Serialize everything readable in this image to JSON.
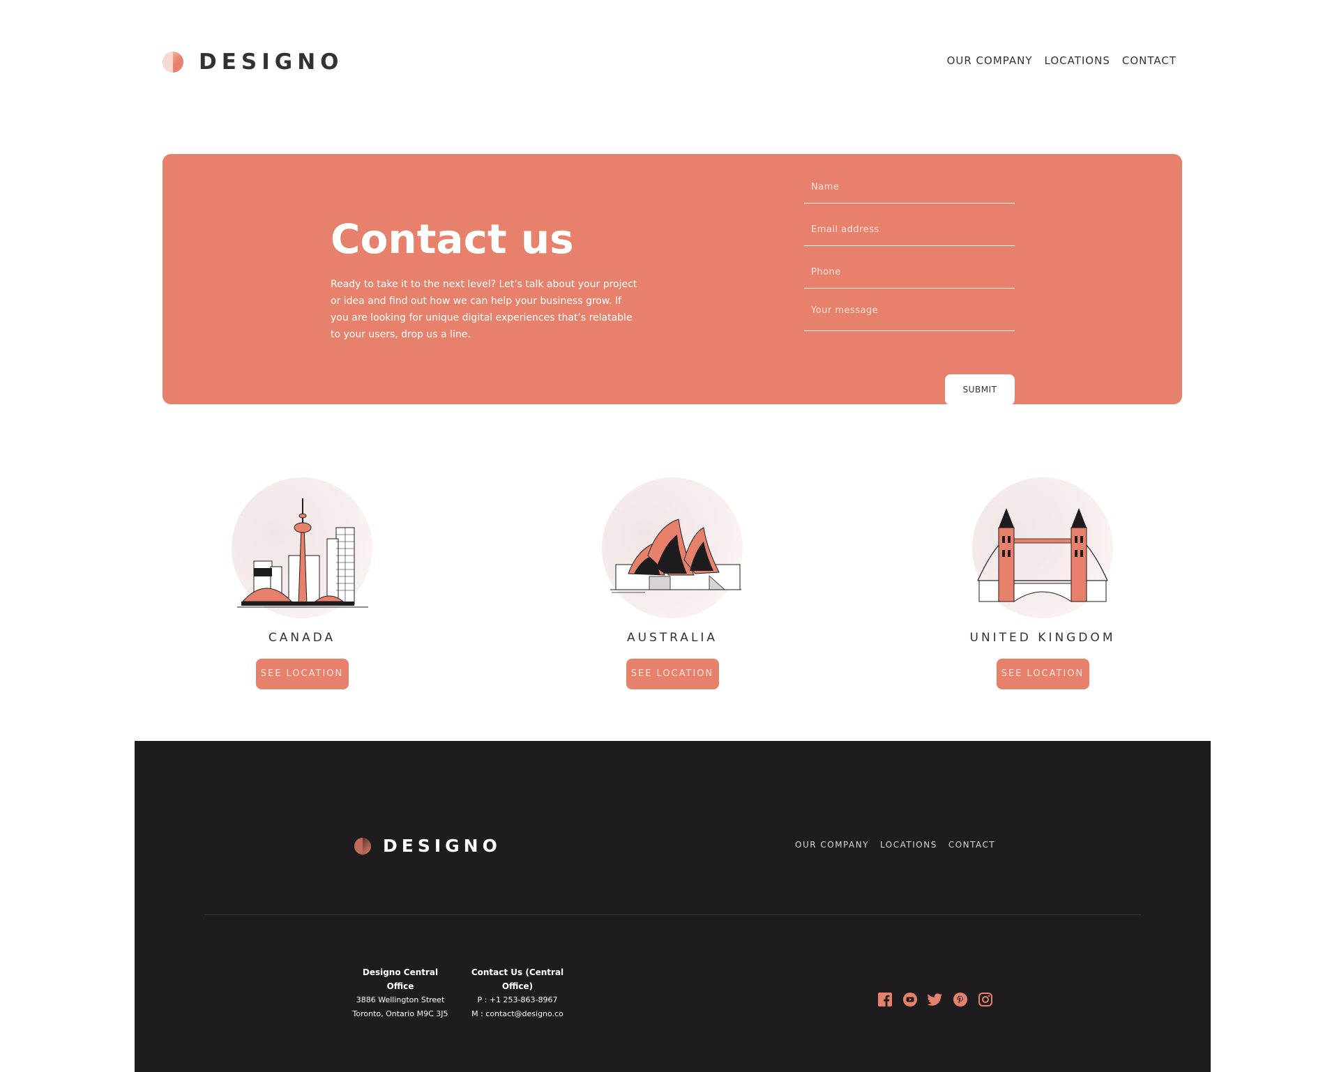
{
  "header": {
    "logo_text": "DESIGNO",
    "nav": [
      "OUR COMPANY",
      "LOCATIONS",
      "CONTACT"
    ]
  },
  "hero": {
    "title": "Contact us",
    "text": "Ready to take it to the next level? Let’s talk about your project or idea and find out how we can help your business grow. If you are looking for unique digital experiences that’s relatable to your users, drop us a line.",
    "form": {
      "name_placeholder": "Name",
      "email_placeholder": "Email address",
      "phone_placeholder": "Phone",
      "message_placeholder": "Your message",
      "submit_label": "SUBMIT"
    }
  },
  "locations": [
    {
      "name": "CANADA",
      "button": "SEE LOCATION",
      "icon": "toronto-skyline-icon"
    },
    {
      "name": "AUSTRALIA",
      "button": "SEE LOCATION",
      "icon": "sydney-opera-house-icon"
    },
    {
      "name": "UNITED KINGDOM",
      "button": "SEE LOCATION",
      "icon": "tower-bridge-icon"
    }
  ],
  "footer": {
    "logo_text": "DESIGNO",
    "nav": [
      "OUR COMPANY",
      "LOCATIONS",
      "CONTACT"
    ],
    "office": {
      "heading": "Designo Central Office",
      "line1": "3886 Wellington Street",
      "line2": "Toronto, Ontario M9C 3J5"
    },
    "contact": {
      "heading": "Contact Us (Central Office)",
      "phone": "P : +1 253-863-8967",
      "email": "M : contact@designo.co"
    },
    "socials": [
      "facebook-icon",
      "youtube-icon",
      "twitter-icon",
      "pinterest-icon",
      "instagram-icon"
    ]
  },
  "colors": {
    "accent": "#e7816b",
    "dark": "#1e1c1f",
    "text": "#333136"
  }
}
